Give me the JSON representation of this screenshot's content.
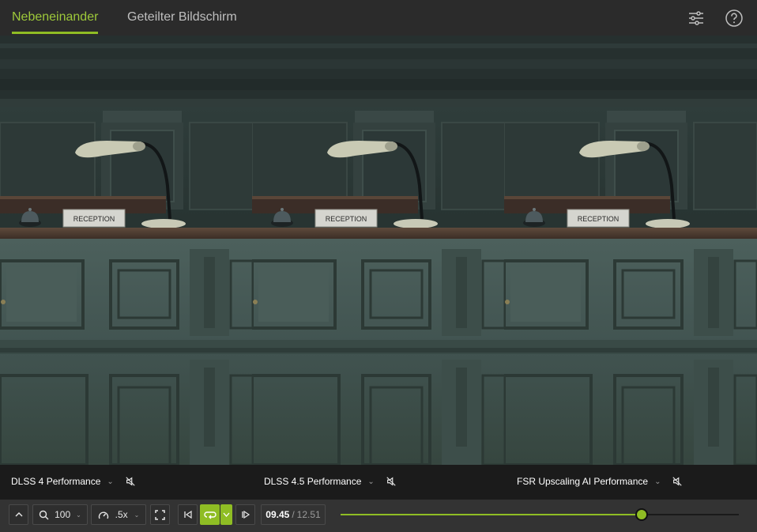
{
  "tabs": [
    {
      "label": "Nebeneinander",
      "active": true
    },
    {
      "label": "Geteilter Bildschirm",
      "active": false
    }
  ],
  "toolbar_icons": {
    "settings": "sliders-icon",
    "help": "help-icon"
  },
  "panels": [
    {
      "label": "DLSS 4 Performance",
      "sign": "RECEPTION"
    },
    {
      "label": "DLSS 4.5 Performance",
      "sign": "RECEPTION"
    },
    {
      "label": "FSR Upscaling AI Performance",
      "sign": "RECEPTION"
    }
  ],
  "controls": {
    "zoom": "100",
    "speed": ".5x",
    "current_time": "09.45",
    "separator": "/",
    "duration": "12.51",
    "progress_fraction": 0.755
  },
  "colors": {
    "accent": "#8fbd24",
    "background": "#2b2b2b",
    "label_bar": "#1b1b1b"
  }
}
